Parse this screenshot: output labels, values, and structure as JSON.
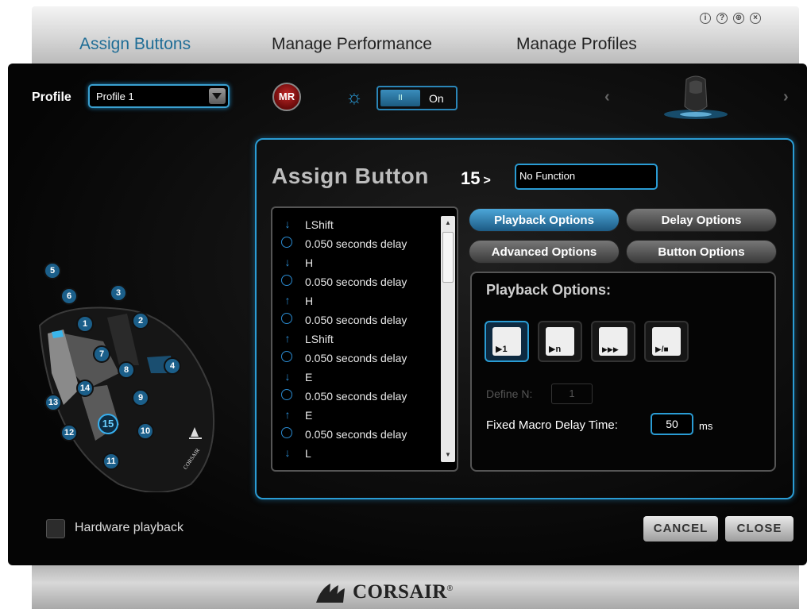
{
  "tabs": [
    {
      "label": "Assign Buttons",
      "active": true
    },
    {
      "label": "Manage Performance",
      "active": false
    },
    {
      "label": "Manage Profiles",
      "active": false
    }
  ],
  "window_icons": [
    "info-icon",
    "help-icon",
    "globe-icon",
    "close-icon"
  ],
  "profile": {
    "label": "Profile",
    "value": "Profile 1"
  },
  "mr_button": {
    "label": "MR"
  },
  "lighting_toggle": {
    "knob": "II",
    "label": "On"
  },
  "device_nav": {
    "prev": "‹",
    "next": "›"
  },
  "mouse_buttons": [
    "1",
    "2",
    "3",
    "4",
    "5",
    "6",
    "7",
    "8",
    "9",
    "10",
    "11",
    "12",
    "13",
    "14",
    "15"
  ],
  "selected_button": "15",
  "mouse_logo": "CORSAIR",
  "assign": {
    "title": "Assign Button",
    "number": "15",
    "arrow": ">",
    "function": "No Function"
  },
  "macro_steps": [
    {
      "icon": "key-down-icon",
      "glyph": "↓",
      "text": "LShift"
    },
    {
      "icon": "clock-icon",
      "glyph": "◷",
      "text": "0.050 seconds delay"
    },
    {
      "icon": "key-down-icon",
      "glyph": "↓",
      "text": "H"
    },
    {
      "icon": "clock-icon",
      "glyph": "◷",
      "text": "0.050 seconds delay"
    },
    {
      "icon": "key-up-icon",
      "glyph": "↑",
      "text": "H"
    },
    {
      "icon": "clock-icon",
      "glyph": "◷",
      "text": "0.050 seconds delay"
    },
    {
      "icon": "key-up-icon",
      "glyph": "↑",
      "text": "LShift"
    },
    {
      "icon": "clock-icon",
      "glyph": "◷",
      "text": "0.050 seconds delay"
    },
    {
      "icon": "key-down-icon",
      "glyph": "↓",
      "text": "E"
    },
    {
      "icon": "clock-icon",
      "glyph": "◷",
      "text": "0.050 seconds delay"
    },
    {
      "icon": "key-up-icon",
      "glyph": "↑",
      "text": "E"
    },
    {
      "icon": "clock-icon",
      "glyph": "◷",
      "text": "0.050 seconds delay"
    },
    {
      "icon": "key-down-icon",
      "glyph": "↓",
      "text": "L"
    }
  ],
  "option_buttons": {
    "playback": "Playback Options",
    "delay": "Delay Options",
    "advanced": "Advanced Options",
    "button": "Button Options"
  },
  "playback": {
    "title": "Playback Options:",
    "modes": [
      {
        "name": "play-once-icon",
        "label": "▶1",
        "active": true
      },
      {
        "name": "play-n-times-icon",
        "label": "▶n",
        "active": false
      },
      {
        "name": "repeat-while-held-icon",
        "label": "▶▶▶",
        "active": false
      },
      {
        "name": "toggle-play-stop-icon",
        "label": "▶/■",
        "active": false
      }
    ],
    "define_n_label": "Define N:",
    "define_n_value": "1",
    "fixed_delay_label": "Fixed Macro Delay Time:",
    "fixed_delay_value": "50",
    "fixed_delay_unit": "ms"
  },
  "hardware_playback": {
    "label": "Hardware playback",
    "checked": false
  },
  "footer": {
    "cancel": "CANCEL",
    "close": "CLOSE"
  },
  "brand": {
    "logo_text": "CORSAIR",
    "mark": "®"
  },
  "colors": {
    "accent": "#2a9cd4",
    "active_tab": "#1f6d96",
    "record": "#c02828"
  }
}
